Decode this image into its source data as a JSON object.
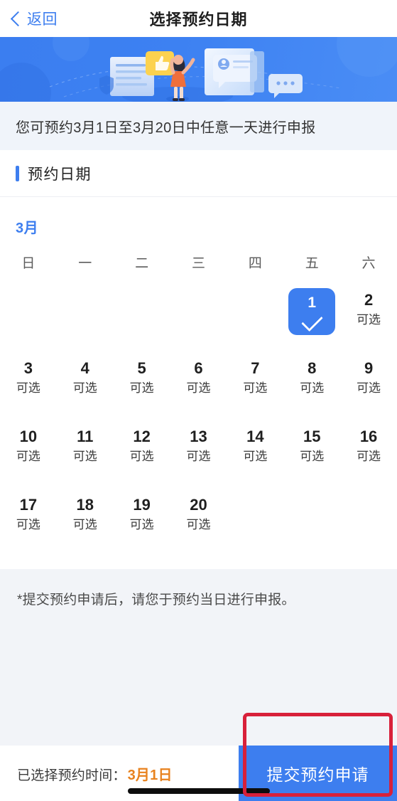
{
  "nav": {
    "back_label": "返回",
    "back_icon": "chevron-left-icon",
    "title": "选择预约日期"
  },
  "banner": {
    "alt": "appointment-illustration",
    "accent": "#3d7eef"
  },
  "notice": {
    "text": "您可预约3月1日至3月20日中任意一天进行申报"
  },
  "section": {
    "title": "预约日期",
    "accent": "#3d7eef"
  },
  "calendar": {
    "month_label": "3月",
    "weekdays": [
      "日",
      "一",
      "二",
      "三",
      "四",
      "五",
      "六"
    ],
    "leading_blanks": 5,
    "available_label": "可选",
    "selected_day": "1",
    "selected_icon": "check-icon",
    "days": [
      {
        "num": "1",
        "status": "",
        "selected": true
      },
      {
        "num": "2",
        "status": "可选",
        "selected": false
      },
      {
        "num": "3",
        "status": "可选",
        "selected": false
      },
      {
        "num": "4",
        "status": "可选",
        "selected": false
      },
      {
        "num": "5",
        "status": "可选",
        "selected": false
      },
      {
        "num": "6",
        "status": "可选",
        "selected": false
      },
      {
        "num": "7",
        "status": "可选",
        "selected": false
      },
      {
        "num": "8",
        "status": "可选",
        "selected": false
      },
      {
        "num": "9",
        "status": "可选",
        "selected": false
      },
      {
        "num": "10",
        "status": "可选",
        "selected": false
      },
      {
        "num": "11",
        "status": "可选",
        "selected": false
      },
      {
        "num": "12",
        "status": "可选",
        "selected": false
      },
      {
        "num": "13",
        "status": "可选",
        "selected": false
      },
      {
        "num": "14",
        "status": "可选",
        "selected": false
      },
      {
        "num": "15",
        "status": "可选",
        "selected": false
      },
      {
        "num": "16",
        "status": "可选",
        "selected": false
      },
      {
        "num": "17",
        "status": "可选",
        "selected": false
      },
      {
        "num": "18",
        "status": "可选",
        "selected": false
      },
      {
        "num": "19",
        "status": "可选",
        "selected": false
      },
      {
        "num": "20",
        "status": "可选",
        "selected": false
      }
    ]
  },
  "footnote": {
    "text": "*提交预约申请后，请您于预约当日进行申报。"
  },
  "bottom": {
    "selected_label": "已选择预约时间：",
    "selected_value": "3月1日",
    "selected_value_color": "#e8821e",
    "submit_label": "提交预约申请",
    "submit_color": "#3d7eef"
  },
  "annotation": {
    "color": "#d8203a",
    "target": "submit-button"
  }
}
